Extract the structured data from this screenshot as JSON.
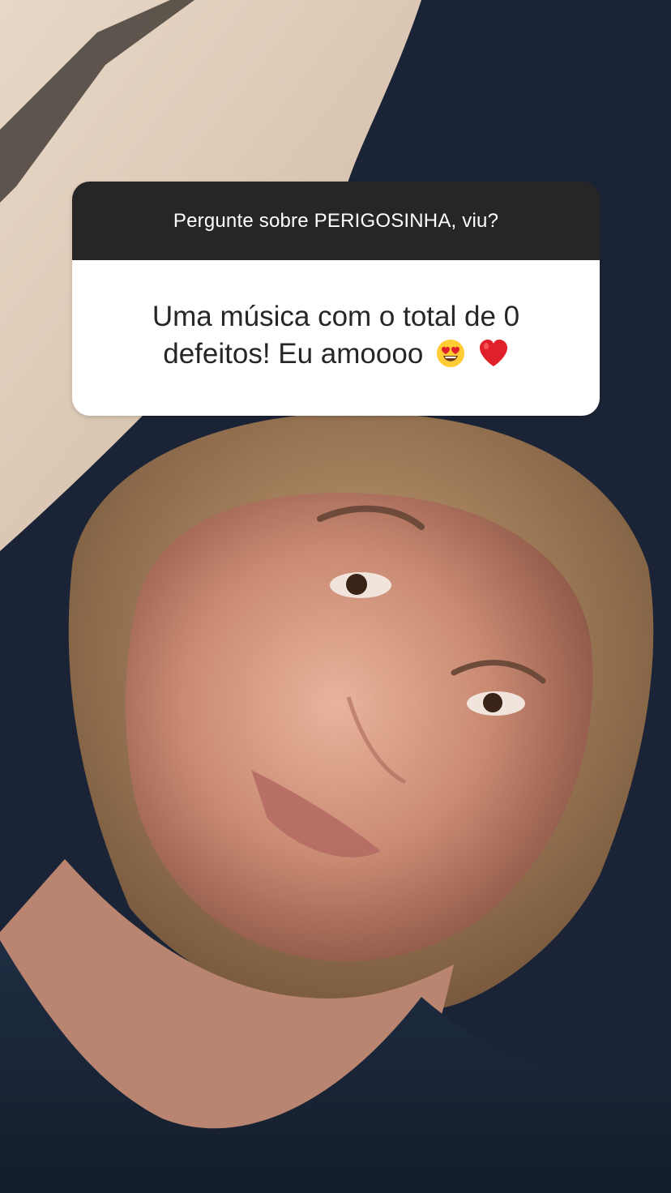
{
  "story": {
    "question": {
      "prompt": "Pergunte sobre PERIGOSINHA, viu?",
      "answer": "Uma música com o total de 0 defeitos! Eu amoooo",
      "emojis": [
        "heart-eyes-emoji",
        "red-heart-emoji"
      ]
    },
    "colors": {
      "header_bg": "#262626",
      "body_bg": "#ffffff",
      "heart": "#e0202a"
    }
  }
}
